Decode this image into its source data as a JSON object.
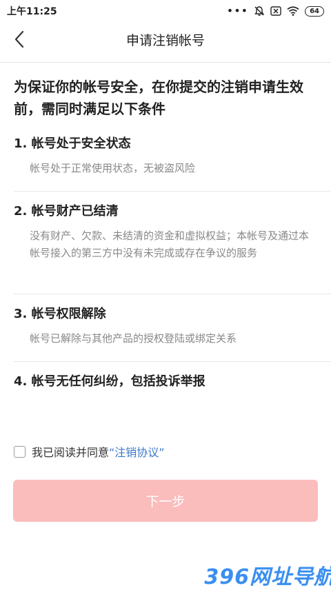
{
  "status_bar": {
    "time": "上午11:25",
    "dots": "•••",
    "battery": "64"
  },
  "nav": {
    "title": "申请注销帐号"
  },
  "intro": "为保证你的帐号安全，在你提交的注销申请生效前，需同时满足以下条件",
  "conditions": [
    {
      "title": "1. 帐号处于安全状态",
      "desc": "帐号处于正常使用状态，无被盗风险"
    },
    {
      "title": "2. 帐号财产已结清",
      "desc": "没有财产、欠款、未结清的资金和虚拟权益；本帐号及通过本帐号接入的第三方中没有未完成或存在争议的服务"
    },
    {
      "title": "3. 帐号权限解除",
      "desc": "帐号已解除与其他产品的授权登陆或绑定关系"
    },
    {
      "title": "4. 帐号无任何纠纷，包括投诉举报",
      "desc": ""
    }
  ],
  "agreement": {
    "text": "我已阅读并同意",
    "link": "“注销协议”",
    "checked": false
  },
  "next_button": {
    "label": "下一步"
  },
  "watermark": "396网址导航",
  "colors": {
    "button_disabled": "#fbbcbc",
    "link": "#3a78c8",
    "desc_text": "#888888"
  }
}
